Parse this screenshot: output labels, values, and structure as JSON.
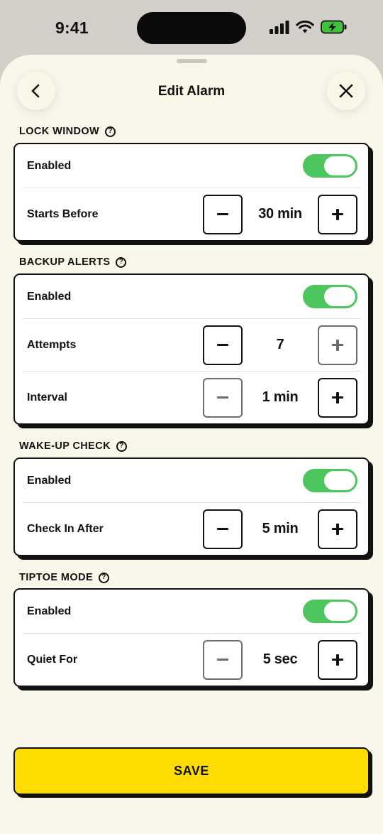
{
  "status_bar": {
    "time": "9:41"
  },
  "header": {
    "title": "Edit Alarm"
  },
  "sections": [
    {
      "title": "LOCK WINDOW",
      "enabled_label": "Enabled",
      "enabled": true,
      "steppers": [
        {
          "label": "Starts Before",
          "value": "30 min",
          "minus_disabled": false,
          "plus_disabled": false
        }
      ]
    },
    {
      "title": "BACKUP ALERTS",
      "enabled_label": "Enabled",
      "enabled": true,
      "steppers": [
        {
          "label": "Attempts",
          "value": "7",
          "minus_disabled": false,
          "plus_disabled": true
        },
        {
          "label": "Interval",
          "value": "1 min",
          "minus_disabled": true,
          "plus_disabled": false
        }
      ]
    },
    {
      "title": "WAKE-UP CHECK",
      "enabled_label": "Enabled",
      "enabled": true,
      "steppers": [
        {
          "label": "Check In After",
          "value": "5 min",
          "minus_disabled": false,
          "plus_disabled": false
        }
      ]
    },
    {
      "title": "TIPTOE MODE",
      "enabled_label": "Enabled",
      "enabled": true,
      "steppers": [
        {
          "label": "Quiet For",
          "value": "5 sec",
          "minus_disabled": true,
          "plus_disabled": false
        }
      ]
    }
  ],
  "help_glyph": "?",
  "save_label": "SAVE",
  "colors": {
    "accent_yellow": "#ffdc00",
    "toggle_on": "#4dc65e",
    "sheet_bg": "#f8f7ea",
    "battery_green": "#3ec43a"
  }
}
